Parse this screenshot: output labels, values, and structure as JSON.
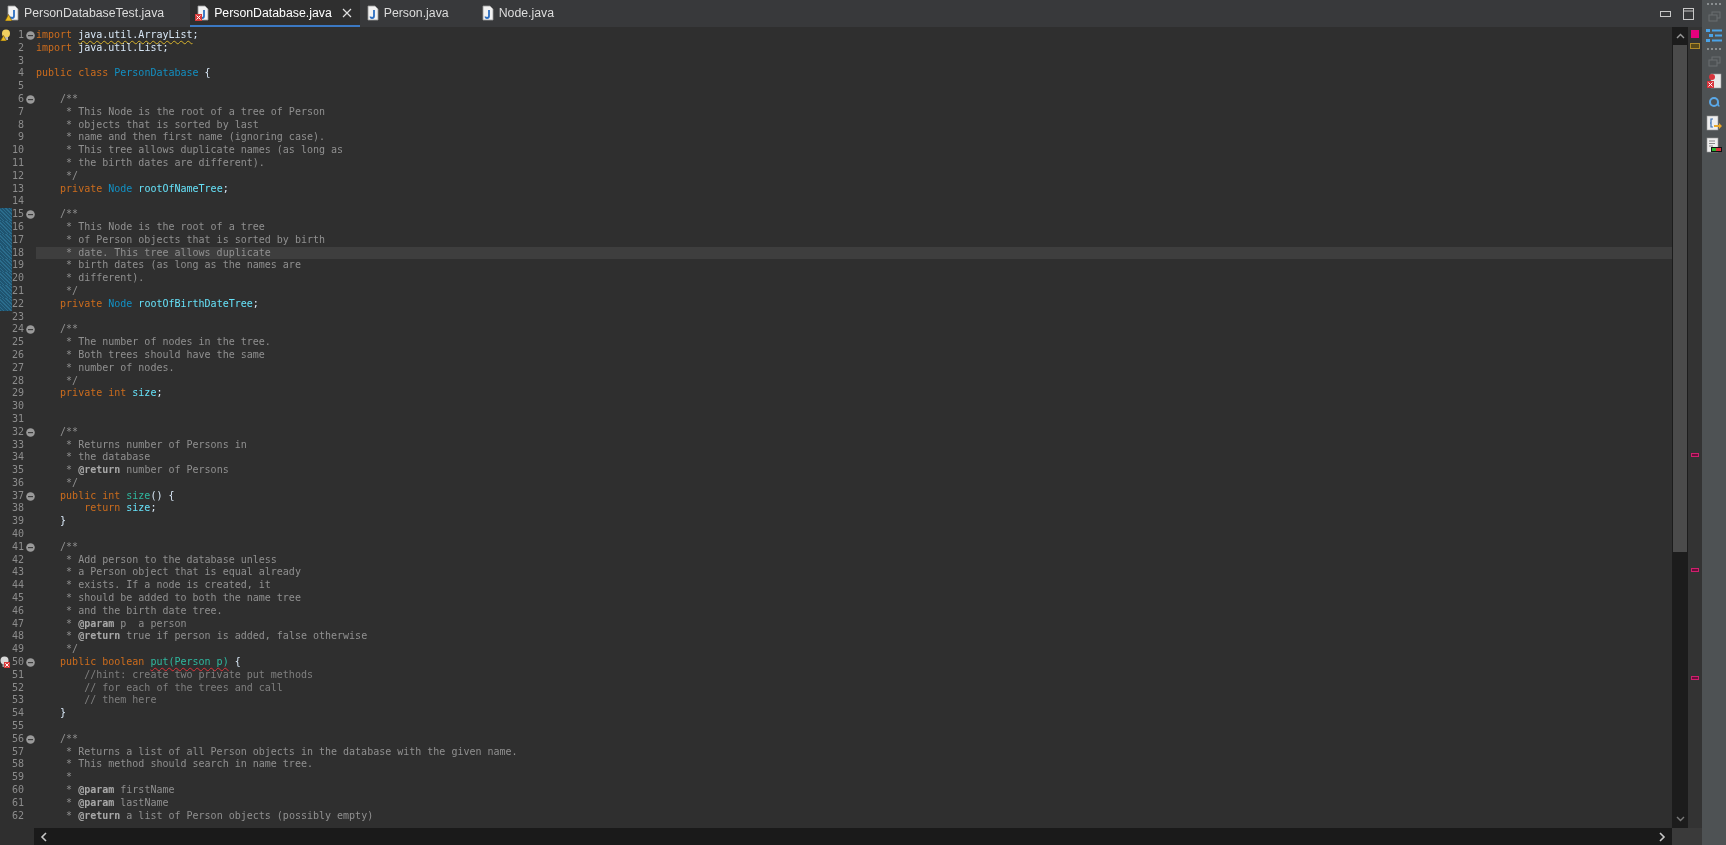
{
  "tabs": [
    {
      "label": "PersonDatabaseTest.java",
      "selected": false,
      "warning": true,
      "error": false
    },
    {
      "label": "PersonDatabase.java",
      "selected": true,
      "warning": false,
      "error": true
    },
    {
      "label": "Person.java",
      "selected": false,
      "warning": false,
      "error": false
    },
    {
      "label": "Node.java",
      "selected": false,
      "warning": false,
      "error": false
    }
  ],
  "lines": [
    {
      "number": "1",
      "fold": true,
      "warning": true,
      "error": false,
      "changed": false,
      "current": false,
      "tokens": [
        {
          "kind": "keyword",
          "text": "import "
        },
        {
          "kind": "warning",
          "text": "java.util.ArrayList"
        },
        {
          "kind": "plain",
          "text": ";"
        }
      ]
    },
    {
      "number": "2",
      "fold": false,
      "warning": false,
      "error": false,
      "changed": false,
      "current": false,
      "tokens": [
        {
          "kind": "keyword",
          "text": "import "
        },
        {
          "kind": "plain",
          "text": "java.util.List;"
        }
      ]
    },
    {
      "number": "3",
      "fold": false,
      "warning": false,
      "error": false,
      "changed": false,
      "current": false
    },
    {
      "number": "4",
      "fold": false,
      "warning": false,
      "error": false,
      "changed": false,
      "current": false,
      "tokens": [
        {
          "kind": "keyword",
          "text": "public class "
        },
        {
          "kind": "type",
          "text": "PersonDatabase"
        },
        {
          "kind": "plain",
          "text": " {"
        }
      ]
    },
    {
      "number": "5",
      "fold": false,
      "warning": false,
      "error": false,
      "changed": false,
      "current": false
    },
    {
      "number": "6",
      "fold": true,
      "warning": false,
      "error": false,
      "changed": false,
      "current": false,
      "tokens": [
        {
          "kind": "doc",
          "text": "    /**"
        }
      ]
    },
    {
      "number": "7",
      "fold": false,
      "warning": false,
      "error": false,
      "changed": false,
      "current": false,
      "tokens": [
        {
          "kind": "doc",
          "text": "     * This Node is the root of a tree of Person"
        }
      ]
    },
    {
      "number": "8",
      "fold": false,
      "warning": false,
      "error": false,
      "changed": false,
      "current": false,
      "tokens": [
        {
          "kind": "doc",
          "text": "     * objects that is sorted by last"
        }
      ]
    },
    {
      "number": "9",
      "fold": false,
      "warning": false,
      "error": false,
      "changed": false,
      "current": false,
      "tokens": [
        {
          "kind": "doc",
          "text": "     * name and then first name (ignoring case)."
        }
      ]
    },
    {
      "number": "10",
      "fold": false,
      "warning": false,
      "error": false,
      "changed": false,
      "current": false,
      "tokens": [
        {
          "kind": "doc",
          "text": "     * This tree allows duplicate names (as long as"
        }
      ]
    },
    {
      "number": "11",
      "fold": false,
      "warning": false,
      "error": false,
      "changed": false,
      "current": false,
      "tokens": [
        {
          "kind": "doc",
          "text": "     * the birth dates are different)."
        }
      ]
    },
    {
      "number": "12",
      "fold": false,
      "warning": false,
      "error": false,
      "changed": false,
      "current": false,
      "tokens": [
        {
          "kind": "doc",
          "text": "     */"
        }
      ]
    },
    {
      "number": "13",
      "fold": false,
      "warning": false,
      "error": false,
      "changed": false,
      "current": false,
      "tokens": [
        {
          "kind": "keyword",
          "text": "    private "
        },
        {
          "kind": "type",
          "text": "Node "
        },
        {
          "kind": "field",
          "text": "rootOfNameTree"
        },
        {
          "kind": "plain",
          "text": ";"
        }
      ]
    },
    {
      "number": "14",
      "fold": false,
      "warning": false,
      "error": false,
      "changed": false,
      "current": false
    },
    {
      "number": "15",
      "fold": true,
      "warning": false,
      "error": false,
      "changed": true,
      "current": false,
      "tokens": [
        {
          "kind": "doc",
          "text": "    /**"
        }
      ]
    },
    {
      "number": "16",
      "fold": false,
      "warning": false,
      "error": false,
      "changed": true,
      "current": false,
      "tokens": [
        {
          "kind": "doc",
          "text": "     * This Node is the root of a tree"
        }
      ]
    },
    {
      "number": "17",
      "fold": false,
      "warning": false,
      "error": false,
      "changed": true,
      "current": false,
      "tokens": [
        {
          "kind": "doc",
          "text": "     * of Person objects that is sorted by birth"
        }
      ]
    },
    {
      "number": "18",
      "fold": false,
      "warning": false,
      "error": false,
      "changed": true,
      "current": true,
      "tokens": [
        {
          "kind": "doc",
          "text": "     * date. This tree allows duplicate"
        }
      ]
    },
    {
      "number": "19",
      "fold": false,
      "warning": false,
      "error": false,
      "changed": true,
      "current": false,
      "tokens": [
        {
          "kind": "doc",
          "text": "     * birth dates (as long as the names are"
        }
      ]
    },
    {
      "number": "20",
      "fold": false,
      "warning": false,
      "error": false,
      "changed": true,
      "current": false,
      "tokens": [
        {
          "kind": "doc",
          "text": "     * different)."
        }
      ]
    },
    {
      "number": "21",
      "fold": false,
      "warning": false,
      "error": false,
      "changed": true,
      "current": false,
      "tokens": [
        {
          "kind": "doc",
          "text": "     */"
        }
      ]
    },
    {
      "number": "22",
      "fold": false,
      "warning": false,
      "error": false,
      "changed": true,
      "current": false,
      "tokens": [
        {
          "kind": "keyword",
          "text": "    private "
        },
        {
          "kind": "type",
          "text": "Node "
        },
        {
          "kind": "field",
          "text": "rootOfBirthDateTree"
        },
        {
          "kind": "plain",
          "text": ";"
        }
      ]
    },
    {
      "number": "23",
      "fold": false,
      "warning": false,
      "error": false,
      "changed": false,
      "current": false
    },
    {
      "number": "24",
      "fold": true,
      "warning": false,
      "error": false,
      "changed": false,
      "current": false,
      "tokens": [
        {
          "kind": "doc",
          "text": "    /**"
        }
      ]
    },
    {
      "number": "25",
      "fold": false,
      "warning": false,
      "error": false,
      "changed": false,
      "current": false,
      "tokens": [
        {
          "kind": "doc",
          "text": "     * The number of nodes in the tree."
        }
      ]
    },
    {
      "number": "26",
      "fold": false,
      "warning": false,
      "error": false,
      "changed": false,
      "current": false,
      "tokens": [
        {
          "kind": "doc",
          "text": "     * Both trees should have the same"
        }
      ]
    },
    {
      "number": "27",
      "fold": false,
      "warning": false,
      "error": false,
      "changed": false,
      "current": false,
      "tokens": [
        {
          "kind": "doc",
          "text": "     * number of nodes."
        }
      ]
    },
    {
      "number": "28",
      "fold": false,
      "warning": false,
      "error": false,
      "changed": false,
      "current": false,
      "tokens": [
        {
          "kind": "doc",
          "text": "     */"
        }
      ]
    },
    {
      "number": "29",
      "fold": false,
      "warning": false,
      "error": false,
      "changed": false,
      "current": false,
      "tokens": [
        {
          "kind": "keyword",
          "text": "    private int "
        },
        {
          "kind": "field",
          "text": "size"
        },
        {
          "kind": "plain",
          "text": ";"
        }
      ]
    },
    {
      "number": "30",
      "fold": false,
      "warning": false,
      "error": false,
      "changed": false,
      "current": false
    },
    {
      "number": "31",
      "fold": false,
      "warning": false,
      "error": false,
      "changed": false,
      "current": false
    },
    {
      "number": "32",
      "fold": true,
      "warning": false,
      "error": false,
      "changed": false,
      "current": false,
      "tokens": [
        {
          "kind": "doc",
          "text": "    /**"
        }
      ]
    },
    {
      "number": "33",
      "fold": false,
      "warning": false,
      "error": false,
      "changed": false,
      "current": false,
      "tokens": [
        {
          "kind": "doc",
          "text": "     * Returns number of Persons in"
        }
      ]
    },
    {
      "number": "34",
      "fold": false,
      "warning": false,
      "error": false,
      "changed": false,
      "current": false,
      "tokens": [
        {
          "kind": "doc",
          "text": "     * the database"
        }
      ]
    },
    {
      "number": "35",
      "fold": false,
      "warning": false,
      "error": false,
      "changed": false,
      "current": false,
      "tokens": [
        {
          "kind": "doc",
          "text": "     * "
        },
        {
          "kind": "tag",
          "text": "@return"
        },
        {
          "kind": "doc",
          "text": " number of Persons"
        }
      ]
    },
    {
      "number": "36",
      "fold": false,
      "warning": false,
      "error": false,
      "changed": false,
      "current": false,
      "tokens": [
        {
          "kind": "doc",
          "text": "     */"
        }
      ]
    },
    {
      "number": "37",
      "fold": true,
      "warning": false,
      "error": false,
      "changed": false,
      "current": false,
      "tokens": [
        {
          "kind": "keyword",
          "text": "    public int "
        },
        {
          "kind": "method",
          "text": "size"
        },
        {
          "kind": "plain",
          "text": "() {"
        }
      ]
    },
    {
      "number": "38",
      "fold": false,
      "warning": false,
      "error": false,
      "changed": false,
      "current": false,
      "tokens": [
        {
          "kind": "keyword",
          "text": "        return "
        },
        {
          "kind": "field",
          "text": "size"
        },
        {
          "kind": "plain",
          "text": ";"
        }
      ]
    },
    {
      "number": "39",
      "fold": false,
      "warning": false,
      "error": false,
      "changed": false,
      "current": false,
      "tokens": [
        {
          "kind": "plain",
          "text": "    }"
        }
      ]
    },
    {
      "number": "40",
      "fold": false,
      "warning": false,
      "error": false,
      "changed": false,
      "current": false
    },
    {
      "number": "41",
      "fold": true,
      "warning": false,
      "error": false,
      "changed": false,
      "current": false,
      "tokens": [
        {
          "kind": "doc",
          "text": "    /**"
        }
      ]
    },
    {
      "number": "42",
      "fold": false,
      "warning": false,
      "error": false,
      "changed": false,
      "current": false,
      "tokens": [
        {
          "kind": "doc",
          "text": "     * Add person to the database unless"
        }
      ]
    },
    {
      "number": "43",
      "fold": false,
      "warning": false,
      "error": false,
      "changed": false,
      "current": false,
      "tokens": [
        {
          "kind": "doc",
          "text": "     * a Person object that is equal already"
        }
      ]
    },
    {
      "number": "44",
      "fold": false,
      "warning": false,
      "error": false,
      "changed": false,
      "current": false,
      "tokens": [
        {
          "kind": "doc",
          "text": "     * exists. If a node is created, it"
        }
      ]
    },
    {
      "number": "45",
      "fold": false,
      "warning": false,
      "error": false,
      "changed": false,
      "current": false,
      "tokens": [
        {
          "kind": "doc",
          "text": "     * should be added to both the name tree"
        }
      ]
    },
    {
      "number": "46",
      "fold": false,
      "warning": false,
      "error": false,
      "changed": false,
      "current": false,
      "tokens": [
        {
          "kind": "doc",
          "text": "     * and the birth date tree."
        }
      ]
    },
    {
      "number": "47",
      "fold": false,
      "warning": false,
      "error": false,
      "changed": false,
      "current": false,
      "tokens": [
        {
          "kind": "doc",
          "text": "     * "
        },
        {
          "kind": "tag",
          "text": "@param"
        },
        {
          "kind": "doc",
          "text": " p  a person"
        }
      ]
    },
    {
      "number": "48",
      "fold": false,
      "warning": false,
      "error": false,
      "changed": false,
      "current": false,
      "tokens": [
        {
          "kind": "doc",
          "text": "     * "
        },
        {
          "kind": "tag",
          "text": "@return"
        },
        {
          "kind": "doc",
          "text": " true if person is added, false otherwise"
        }
      ]
    },
    {
      "number": "49",
      "fold": false,
      "warning": false,
      "error": false,
      "changed": false,
      "current": false,
      "tokens": [
        {
          "kind": "doc",
          "text": "     */"
        }
      ]
    },
    {
      "number": "50",
      "fold": true,
      "warning": false,
      "error": true,
      "changed": false,
      "current": false,
      "tokens": [
        {
          "kind": "keyword",
          "text": "    public boolean "
        },
        {
          "kind": "error",
          "text": "put(Person p)"
        },
        {
          "kind": "plain",
          "text": " {"
        }
      ]
    },
    {
      "number": "51",
      "fold": false,
      "warning": false,
      "error": false,
      "changed": false,
      "current": false,
      "tokens": [
        {
          "kind": "comment",
          "text": "        //hint: create two private put methods"
        }
      ]
    },
    {
      "number": "52",
      "fold": false,
      "warning": false,
      "error": false,
      "changed": false,
      "current": false,
      "tokens": [
        {
          "kind": "comment",
          "text": "        // for each of the trees and call"
        }
      ]
    },
    {
      "number": "53",
      "fold": false,
      "warning": false,
      "error": false,
      "changed": false,
      "current": false,
      "tokens": [
        {
          "kind": "comment",
          "text": "        // them here"
        }
      ]
    },
    {
      "number": "54",
      "fold": false,
      "warning": false,
      "error": false,
      "changed": false,
      "current": false,
      "tokens": [
        {
          "kind": "plain",
          "text": "    }"
        }
      ]
    },
    {
      "number": "55",
      "fold": false,
      "warning": false,
      "error": false,
      "changed": false,
      "current": false
    },
    {
      "number": "56",
      "fold": true,
      "warning": false,
      "error": false,
      "changed": false,
      "current": false,
      "tokens": [
        {
          "kind": "doc",
          "text": "    /**"
        }
      ]
    },
    {
      "number": "57",
      "fold": false,
      "warning": false,
      "error": false,
      "changed": false,
      "current": false,
      "tokens": [
        {
          "kind": "doc",
          "text": "     * Returns a list of all Person objects in the database with the given name."
        }
      ]
    },
    {
      "number": "58",
      "fold": false,
      "warning": false,
      "error": false,
      "changed": false,
      "current": false,
      "tokens": [
        {
          "kind": "doc",
          "text": "     * This method should search in name tree."
        }
      ]
    },
    {
      "number": "59",
      "fold": false,
      "warning": false,
      "error": false,
      "changed": false,
      "current": false,
      "tokens": [
        {
          "kind": "doc",
          "text": "     *"
        }
      ]
    },
    {
      "number": "60",
      "fold": false,
      "warning": false,
      "error": false,
      "changed": false,
      "current": false,
      "tokens": [
        {
          "kind": "doc",
          "text": "     * "
        },
        {
          "kind": "tag",
          "text": "@param"
        },
        {
          "kind": "doc",
          "text": " firstName"
        }
      ]
    },
    {
      "number": "61",
      "fold": false,
      "warning": false,
      "error": false,
      "changed": false,
      "current": false,
      "tokens": [
        {
          "kind": "doc",
          "text": "     * "
        },
        {
          "kind": "tag",
          "text": "@param"
        },
        {
          "kind": "doc",
          "text": " lastName"
        }
      ]
    },
    {
      "number": "62",
      "fold": false,
      "warning": false,
      "error": false,
      "changed": false,
      "current": false,
      "tokens": [
        {
          "kind": "doc",
          "text": "     * "
        },
        {
          "kind": "tag",
          "text": "@return"
        },
        {
          "kind": "doc",
          "text": " a list of Person objects (possibly empty)"
        }
      ]
    }
  ]
}
